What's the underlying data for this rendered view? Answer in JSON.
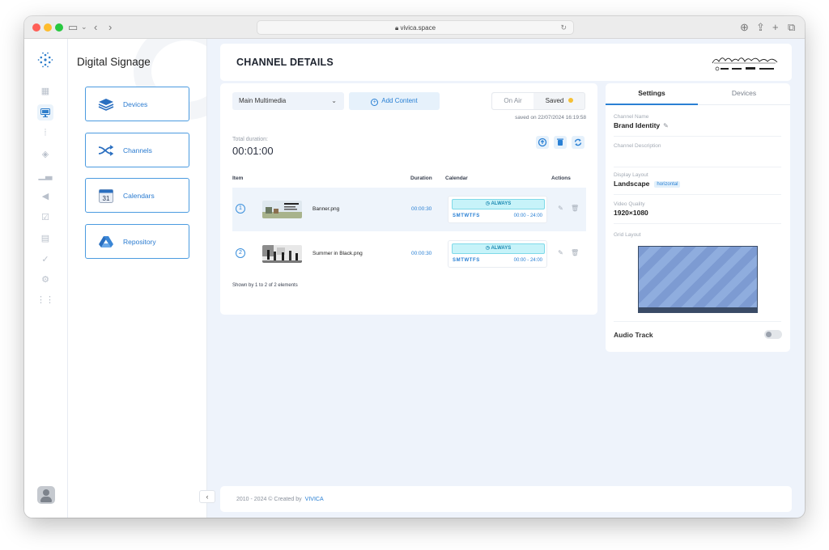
{
  "browser": {
    "url": "vivica.space",
    "colors": {
      "close": "#ff5f57",
      "minimize": "#febc2e",
      "zoom": "#28c840"
    }
  },
  "rail": {
    "icons": [
      "app-logo-icon",
      "dashboard-icon",
      "monitor-icon",
      "signal-icon",
      "layers-icon",
      "chart-icon",
      "audio-icon",
      "check-icon",
      "document-icon",
      "approve-icon",
      "settings-icon",
      "grid-icon"
    ],
    "active": "monitor-icon"
  },
  "sidemenu": {
    "title": "Digital Signage",
    "items": [
      {
        "label": "Devices",
        "icon": "layers-icon"
      },
      {
        "label": "Channels",
        "icon": "shuffle-icon"
      },
      {
        "label": "Calendars",
        "icon": "calendar-icon",
        "icon_text": "31"
      },
      {
        "label": "Repository",
        "icon": "drive-icon"
      }
    ]
  },
  "header": {
    "title": "CHANNEL DETAILS"
  },
  "toolbar": {
    "select_value": "Main Multimedia",
    "add_content": "Add Content",
    "on_air": "On Air",
    "saved": "Saved",
    "saved_on": "saved on 22/07/2024 16:19:58"
  },
  "total": {
    "label": "Total duration:",
    "value": "00:01:00"
  },
  "table": {
    "headers": [
      "Item",
      "Duration",
      "Calendar",
      "Actions"
    ],
    "rows": [
      {
        "index": "1",
        "file": "Banner.png",
        "duration": "00:00:30",
        "always": "ALWAYS",
        "days": "SMTWTFS",
        "hours": "00:00 - 24:00"
      },
      {
        "index": "2",
        "file": "Summer in Black.png",
        "duration": "00:00:30",
        "always": "ALWAYS",
        "days": "SMTWTFS",
        "hours": "00:00 - 24:00"
      }
    ],
    "footer": "Shown by 1 to 2 of 2 elements"
  },
  "settings": {
    "tabs": [
      "Settings",
      "Devices"
    ],
    "channel_name_label": "Channel Name",
    "channel_name": "Brand Identity",
    "channel_description_label": "Channel Description",
    "channel_description": "",
    "display_layout_label": "Display Layout",
    "display_layout": "Landscape",
    "display_layout_badge": "horizontal",
    "video_quality_label": "Video Quality",
    "video_quality": "1920×1080",
    "grid_layout_label": "Grid Layout",
    "audio_track_label": "Audio Track",
    "audio_track_on": false
  },
  "footer": {
    "copyright": "2010 - 2024 © Created by",
    "brand": "VIVICA"
  }
}
